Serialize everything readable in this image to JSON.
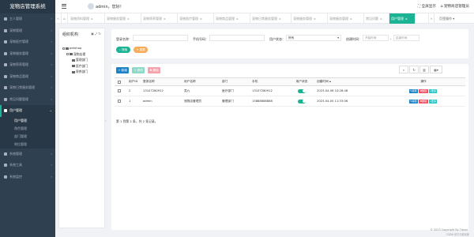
{
  "app": {
    "title": "宠物店管理系统"
  },
  "sidebar": {
    "items": [
      {
        "label": "主人管理"
      },
      {
        "label": "宠物管理"
      },
      {
        "label": "宠物医疗管理"
      },
      {
        "label": "宠物服务管理"
      },
      {
        "label": "宠物寄养管理"
      },
      {
        "label": "宠物商品管理"
      },
      {
        "label": "宠物日常服务管理"
      },
      {
        "label": "常见问题管理"
      },
      {
        "label": "用户管理"
      }
    ],
    "submenu": [
      "用户管理",
      "角色管理",
      "部门管理",
      "岗位管理"
    ],
    "bottom_items": [
      {
        "label": "系统管理"
      },
      {
        "label": "系统工具"
      },
      {
        "label": "系统监控"
      }
    ]
  },
  "header": {
    "user": "admin，您好！",
    "fullscreen": "全屏显示",
    "brand": "宠物商店管理员"
  },
  "tabs": [
    {
      "label": "宠物资料管理"
    },
    {
      "label": "宠物服务管理"
    },
    {
      "label": "宠物寄养管理"
    },
    {
      "label": "宠物医疗管理"
    },
    {
      "label": "宠物商品管理"
    },
    {
      "label": "宠物日常服务管理"
    },
    {
      "label": "宠物服务管理"
    },
    {
      "label": "宠物服务管理"
    },
    {
      "label": "常见问题"
    },
    {
      "label": "用户管理"
    }
  ],
  "tab_ops": "页签操作",
  "org": {
    "title": "组织机构",
    "tree": [
      "petshop",
      "宠物店理",
      "管理部门",
      "医疗部门",
      "寄养部门"
    ]
  },
  "search": {
    "login_name_label": "登录名称：",
    "phone_label": "手机号码：",
    "status_label": "用户状态：",
    "status_value": "所有",
    "created_label": "创建时间：",
    "start_placeholder": "开始时间",
    "end_placeholder": "结束时间",
    "search_btn": "搜索",
    "reset_btn": "重置"
  },
  "toolbar": {
    "add": "新增",
    "edit": "修改",
    "delete": "删除"
  },
  "table": {
    "headers": [
      "",
      "用户ID",
      "登录名称",
      "用户名称",
      "部门",
      "手机",
      "用户状态",
      "创建时间",
      "操作"
    ],
    "rows": [
      {
        "id": "2",
        "login": "13107280912",
        "name": "吴九",
        "dept": "医疗部门",
        "phone": "13107280912",
        "status": "启用",
        "created": "2023-04-06 10:28:48"
      },
      {
        "id": "1",
        "login": "admin",
        "name": "宠物店管理员",
        "dept": "管理部门",
        "phone": "15888888888",
        "status": "启用",
        "created": "2023-04-05 11:33:06"
      }
    ],
    "row_buttons": {
      "edit": "编辑",
      "delete": "删除",
      "more": "更多"
    },
    "page_info": "第 1 到第 2 条，共 2 条记录。"
  },
  "footer": {
    "copyright": "© 2023 Copyright By Tdxxx",
    "watermark": "CSDN @平凡老玩家"
  },
  "colors": {
    "sidebar": "#2f4050",
    "accent": "#1ab394",
    "warn": "#f8ac59",
    "danger": "#ed5565",
    "info": "#23c6c8",
    "primary": "#1c84c6"
  }
}
